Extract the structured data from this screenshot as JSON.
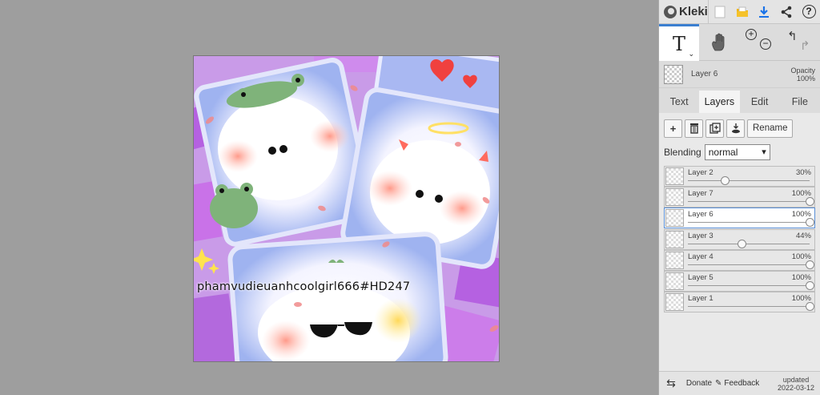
{
  "app": {
    "name": "Kleki"
  },
  "canvas": {
    "overlay_text": "phamvudieuanhcoolgirl666#HD247"
  },
  "topbar": {
    "icons": [
      "new-file-icon",
      "open-folder-icon",
      "download-icon",
      "share-icon",
      "help-icon"
    ],
    "help_glyph": "?"
  },
  "tools": {
    "text_tool_glyph": "T",
    "hand_tool_glyph": "✋",
    "zoom_in_glyph": "+",
    "zoom_out_glyph": "−",
    "undo_glyph": "↰",
    "redo_glyph": "↱"
  },
  "current_layer": {
    "name": "Layer 6",
    "opacity_label": "Opacity",
    "opacity_value": "100%"
  },
  "tabs": [
    "Text",
    "Layers",
    "Edit",
    "File"
  ],
  "active_tab": "Layers",
  "layers_panel": {
    "rename_label": "Rename",
    "blending_label": "Blending",
    "blending_value": "normal",
    "layers": [
      {
        "name": "Layer 2",
        "opacity": "30%",
        "level": 0.3,
        "selected": false
      },
      {
        "name": "Layer 7",
        "opacity": "100%",
        "level": 1.0,
        "selected": false
      },
      {
        "name": "Layer 6",
        "opacity": "100%",
        "level": 1.0,
        "selected": true
      },
      {
        "name": "Layer 3",
        "opacity": "44%",
        "level": 0.44,
        "selected": false
      },
      {
        "name": "Layer 4",
        "opacity": "100%",
        "level": 1.0,
        "selected": false
      },
      {
        "name": "Layer 5",
        "opacity": "100%",
        "level": 1.0,
        "selected": false
      },
      {
        "name": "Layer 1",
        "opacity": "100%",
        "level": 1.0,
        "selected": false
      }
    ]
  },
  "bottombar": {
    "donate_label": "Donate",
    "feedback_label": "Feedback",
    "updated_label": "updated",
    "updated_date": "2022-03-12"
  },
  "colors": {
    "accent": "#3b7fd0",
    "download": "#1a73e8",
    "folder": "#f0b400"
  }
}
